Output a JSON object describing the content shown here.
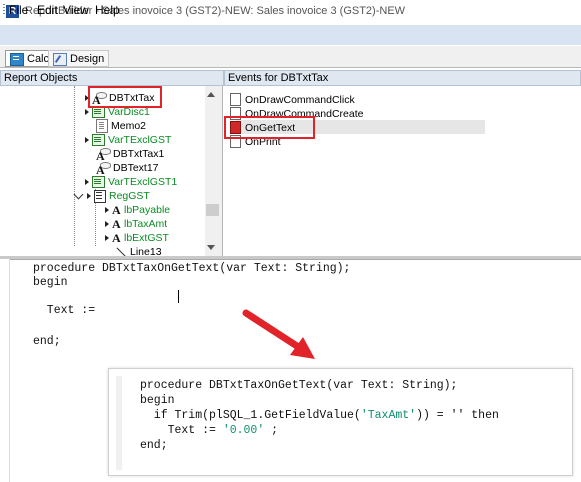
{
  "window": {
    "title": "ReportBuilder - Sales inovoice 3 (GST2)-NEW: Sales inovoice 3 (GST2)-NEW",
    "app_icon_glyph": "R"
  },
  "menu": [
    "File",
    "Edit",
    "View",
    "Help"
  ],
  "tabs": [
    {
      "label": "Calc",
      "icon": "calculator-icon",
      "active": true
    },
    {
      "label": "Design",
      "icon": "design-pencil-icon",
      "active": false
    }
  ],
  "panels": {
    "report_objects_header": "Report Objects",
    "events_header": "Events for DBTxtTax"
  },
  "tree": [
    {
      "label": "DBTxtTax",
      "icon": "dbtext-icon",
      "color": "#000000",
      "selected_callout": true
    },
    {
      "label": "VarDisc1",
      "icon": "variable-icon",
      "color": "#0c8a24"
    },
    {
      "label": "Memo2",
      "icon": "memo-icon",
      "color": "#000000"
    },
    {
      "label": "VarTExclGST",
      "icon": "variable-icon",
      "color": "#0c8a24"
    },
    {
      "label": "DBTxtTax1",
      "icon": "dbtext-icon",
      "color": "#000000"
    },
    {
      "label": "DBText17",
      "icon": "dbtext-icon",
      "color": "#000000"
    },
    {
      "label": "VarTExclGST1",
      "icon": "variable-icon",
      "color": "#0c8a24"
    },
    {
      "label": "RegGST",
      "icon": "region-icon",
      "color": "#0c8a24"
    },
    {
      "label": "lbPayable",
      "icon": "label-icon",
      "color": "#0c8a24"
    },
    {
      "label": "lbTaxAmt",
      "icon": "label-icon",
      "color": "#0c8a24"
    },
    {
      "label": "lbExtGST",
      "icon": "label-icon",
      "color": "#0c8a24"
    },
    {
      "label": "Line13",
      "icon": "line-icon",
      "color": "#000000"
    }
  ],
  "events": [
    {
      "label": "OnDrawCommandClick",
      "icon": "event-page-icon"
    },
    {
      "label": "OnDrawCommandCreate",
      "icon": "event-page-icon"
    },
    {
      "label": "OnGetText",
      "icon": "event-active-icon",
      "selected": true
    },
    {
      "label": "OnPrint",
      "icon": "event-page-icon"
    }
  ],
  "editor": {
    "lines": [
      "procedure DBTxtTaxOnGetText(var Text: String);",
      "begin",
      "",
      "  Text :=",
      "",
      "end;"
    ]
  },
  "inset_code": {
    "line1": "procedure DBTxtTaxOnGetText(var Text: String);",
    "line2": "begin",
    "line3_a": "  if Trim(plSQL_1.GetFieldValue(",
    "line3_str1": "'TaxAmt'",
    "line3_b": ")) = '' then",
    "line4_a": "    Text := ",
    "line4_str": "'0.00'",
    "line4_b": " ;",
    "line5": "end;"
  },
  "colors": {
    "callout_red": "#e0242a",
    "menu_bg": "#d9e4f3",
    "tree_green": "#0c8a24",
    "string_literal": "#0f8f6f"
  }
}
